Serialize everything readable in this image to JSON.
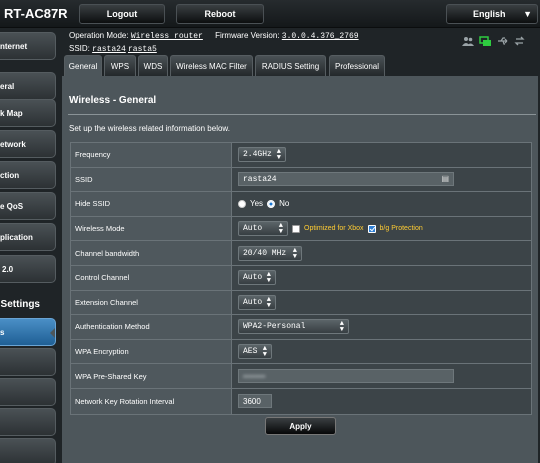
{
  "app": {
    "model": "RT-AC87R"
  },
  "topbar": {
    "logout": "Logout",
    "reboot": "Reboot",
    "language": "English"
  },
  "info": {
    "op_mode_label": "Operation Mode:",
    "op_mode_value": "Wireless router",
    "firmware_label": "Firmware Version:",
    "firmware_value": "3.0.0.4.376_2769",
    "ssid_label": "SSID:",
    "ssid_1": "rasta24",
    "ssid_2": "rasta5"
  },
  "status_icons": [
    "users-icon",
    "network-connected-icon",
    "usb-icon",
    "sync-icon"
  ],
  "sidebar": {
    "items": [
      "nternet",
      "eral",
      "k Map",
      "etwork",
      "ction",
      "e QoS",
      "plication",
      "2.0"
    ],
    "section": "Settings",
    "active_item": "s"
  },
  "tabs": [
    "General",
    "WPS",
    "WDS",
    "Wireless MAC Filter",
    "RADIUS Setting",
    "Professional"
  ],
  "panel": {
    "title": "Wireless - General",
    "description": "Set up the wireless related information below."
  },
  "form": {
    "frequency": {
      "label": "Frequency",
      "value": "2.4GHz"
    },
    "ssid": {
      "label": "SSID",
      "value": "rasta24"
    },
    "hide_ssid": {
      "label": "Hide SSID",
      "yes": "Yes",
      "no": "No",
      "selected": "No"
    },
    "wireless_mode": {
      "label": "Wireless Mode",
      "value": "Auto",
      "opt_xbox": "Optimized for Xbox",
      "opt_bg": "b/g Protection",
      "xbox_checked": false,
      "bg_checked": true
    },
    "channel_bandwidth": {
      "label": "Channel bandwidth",
      "value": "20/40 MHz"
    },
    "control_channel": {
      "label": "Control Channel",
      "value": "Auto"
    },
    "extension_channel": {
      "label": "Extension Channel",
      "value": "Auto"
    },
    "auth_method": {
      "label": "Authentication Method",
      "value": "WPA2-Personal"
    },
    "wpa_encryption": {
      "label": "WPA Encryption",
      "value": "AES"
    },
    "wpa_key": {
      "label": "WPA Pre-Shared Key",
      "value": "••••••••"
    },
    "key_rotation": {
      "label": "Network Key Rotation Interval",
      "value": "3600"
    }
  },
  "apply_label": "Apply",
  "colors": {
    "accent": "#1f5f95",
    "panel": "#4d565b",
    "warning_text": "#ffcc33"
  }
}
